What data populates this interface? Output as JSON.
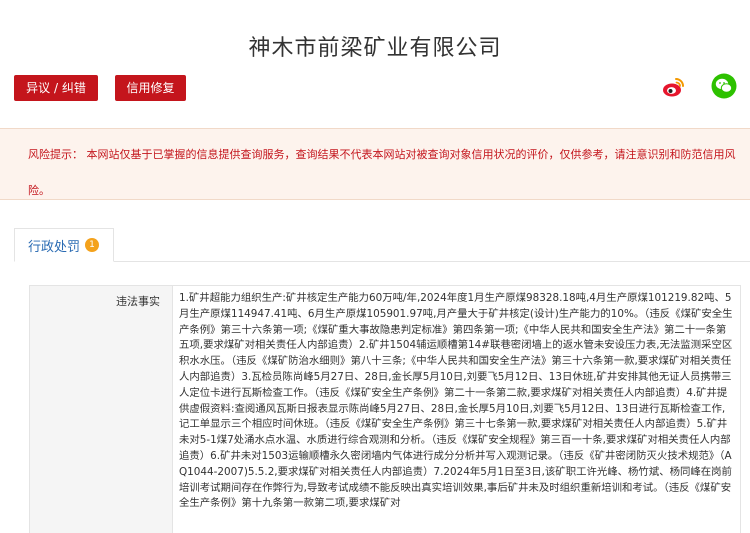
{
  "company": {
    "name": "神木市前梁矿业有限公司"
  },
  "actions": {
    "objection_label": "异议 / 纠错",
    "repair_label": "信用修复"
  },
  "share": {
    "weibo_icon": "weibo-icon",
    "wechat_icon": "wechat-icon",
    "colors": {
      "weibo": "#e6162d",
      "wechat": "#2dc100"
    }
  },
  "risk": {
    "text": "风险提示： 本网站仅基于已掌握的信息提供查询服务，查询结果不代表本网站对被查询对象信用状况的评价，仅供参考，请注意识别和防范信用风险。"
  },
  "tabs": [
    {
      "label": "行政处罚",
      "count": "1"
    }
  ],
  "detail": {
    "label": "违法事实",
    "value": "1.矿井超能力组织生产:矿井核定生产能力60万吨/年,2024年度1月生产原煤98328.18吨,4月生产原煤101219.82吨、5月生产原煤114947.41吨、6月生产原煤105901.97吨,月产量大于矿井核定(设计)生产能力的10%。（违反《煤矿安全生产条例》第三十六条第一项;《煤矿重大事故隐患判定标准》第四条第一项;《中华人民共和国安全生产法》第二十一条第五项,要求煤矿对相关责任人内部追责）2.矿井1504辅运顺槽第14#联巷密闭墙上的返水管未安设压力表,无法监测采空区积水水压。（违反《煤矿防治水细则》第八十三条;《中华人民共和国安全生产法》第三十六条第一款,要求煤矿对相关责任人内部追责）3.瓦检员陈尚峰5月27日、28日,金长厚5月10日,刘要飞5月12日、13日休班,矿井安排其他无证人员携带三人定位卡进行瓦斯检查工作。（违反《煤矿安全生产条例》第二十一条第二款,要求煤矿对相关责任人内部追责）4.矿井提供虚假资料:查阅通风瓦斯日报表显示陈尚峰5月27日、28日,金长厚5月10日,刘要飞5月12日、13日进行瓦斯检查工作,记工单显示三个相应时间休班。（违反《煤矿安全生产条例》第三十七条第一款,要求煤矿对相关责任人内部追责）5.矿井未对5-1煤7处涌水点水温、水质进行综合观测和分析。（违反《煤矿安全规程》第三百一十条,要求煤矿对相关责任人内部追责）6.矿井未对1503运输顺槽永久密闭墙内气体进行成分分析并写入观测记录。（违反《矿井密闭防灭火技术规范》（AQ1044-2007)5.5.2,要求煤矿对相关责任人内部追责）7.2024年5月1日至3日,该矿职工许光峰、杨竹斌、杨同峰在岗前培训考试期间存在作弊行为,导致考试成绩不能反映出真实培训效果,事后矿井未及时组织重新培训和考试。（违反《煤矿安全生产条例》第十九条第一款第二项,要求煤矿对"
  }
}
